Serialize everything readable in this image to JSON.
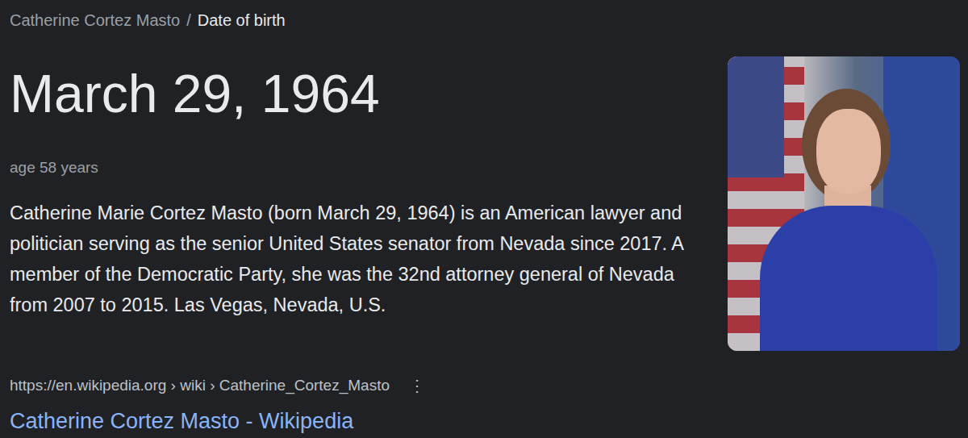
{
  "breadcrumb": {
    "entity": "Catherine Cortez Masto",
    "separator": "/",
    "attribute": "Date of birth"
  },
  "answer": "March 29, 1964",
  "age": "age 58 years",
  "description": "Catherine Marie Cortez Masto (born March 29, 1964) is an American lawyer and politician serving as the senior United States senator from Nevada since 2017. A member of the Democratic Party, she was the 32nd attorney general of Nevada from 2007 to 2015. Las Vegas, Nevada, U.S.",
  "source": {
    "url": "https://en.wikipedia.org › wiki › Catherine_Cortez_Masto",
    "menu": "⋮",
    "title": "Catherine Cortez Masto - Wikipedia"
  }
}
